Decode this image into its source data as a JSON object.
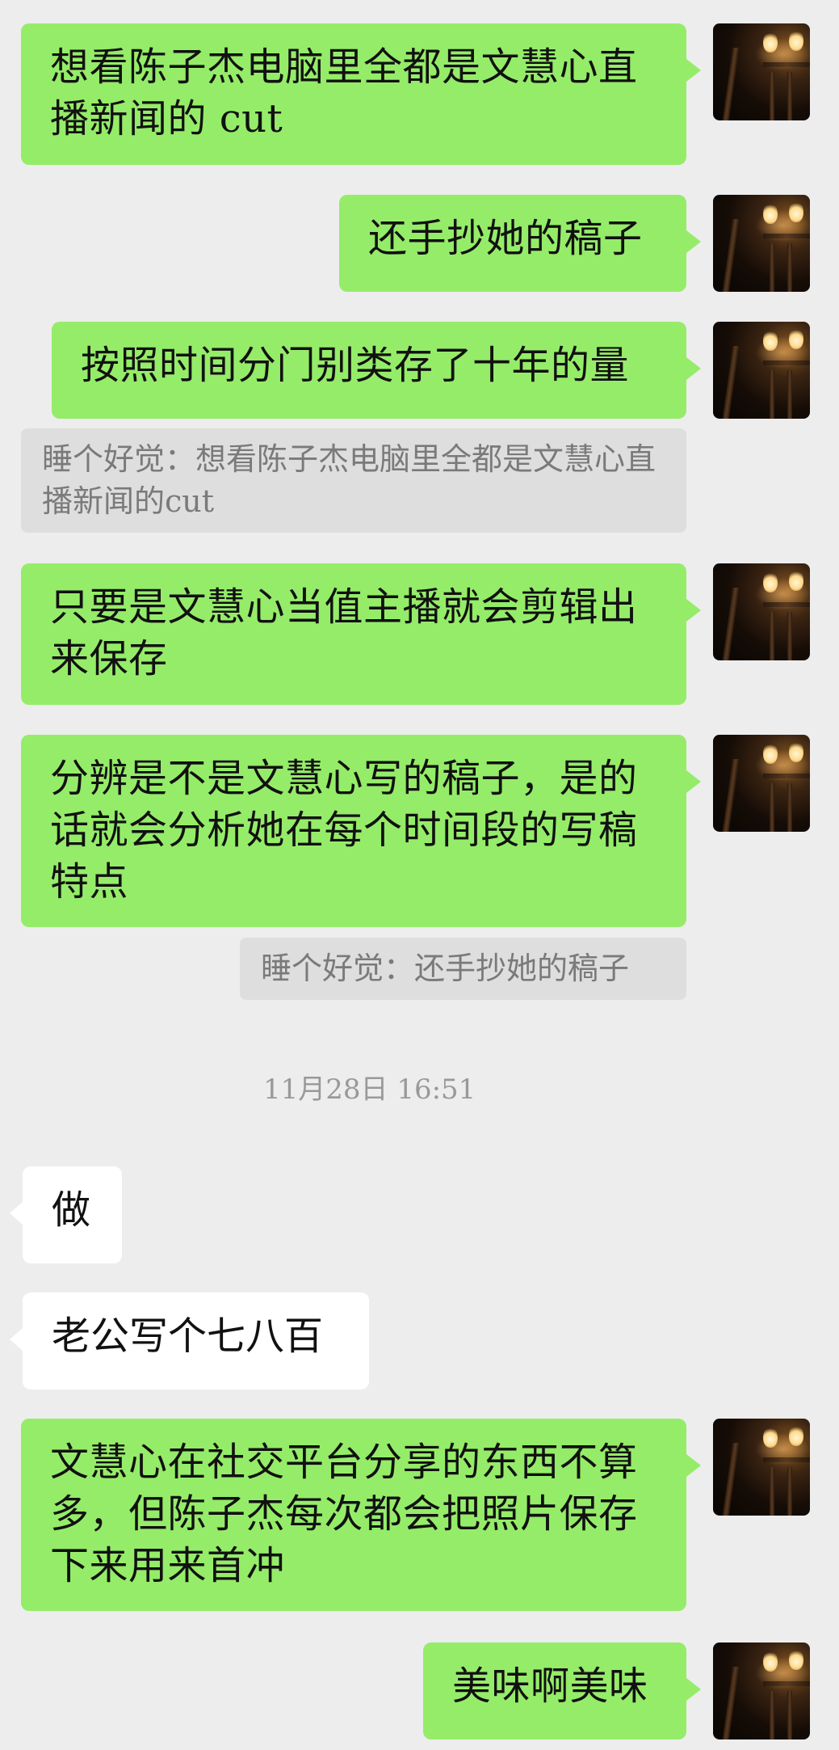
{
  "messages": [
    {
      "text": "想看陈子杰电脑里全都是文慧心直播新闻的 cut"
    },
    {
      "text": "还手抄她的稿子"
    },
    {
      "text": "按照时间分门别类存了十年的量"
    },
    {
      "quote": "睡个好觉：想看陈子杰电脑里全都是文慧心直播新闻的cut"
    },
    {
      "text": "只要是文慧心当值主播就会剪辑出来保存"
    },
    {
      "text": "分辨是不是文慧心写的稿子，是的话就会分析她在每个时间段的写稿特点"
    },
    {
      "quote": "睡个好觉：还手抄她的稿子"
    },
    {
      "timestamp": "11月28日 16:51"
    },
    {
      "text": "做"
    },
    {
      "text": "老公写个七八百"
    },
    {
      "text": "文慧心在社交平台分享的东西不算多，但陈子杰每次都会把照片保存下来用来首冲"
    },
    {
      "text": "美味啊美味"
    }
  ]
}
